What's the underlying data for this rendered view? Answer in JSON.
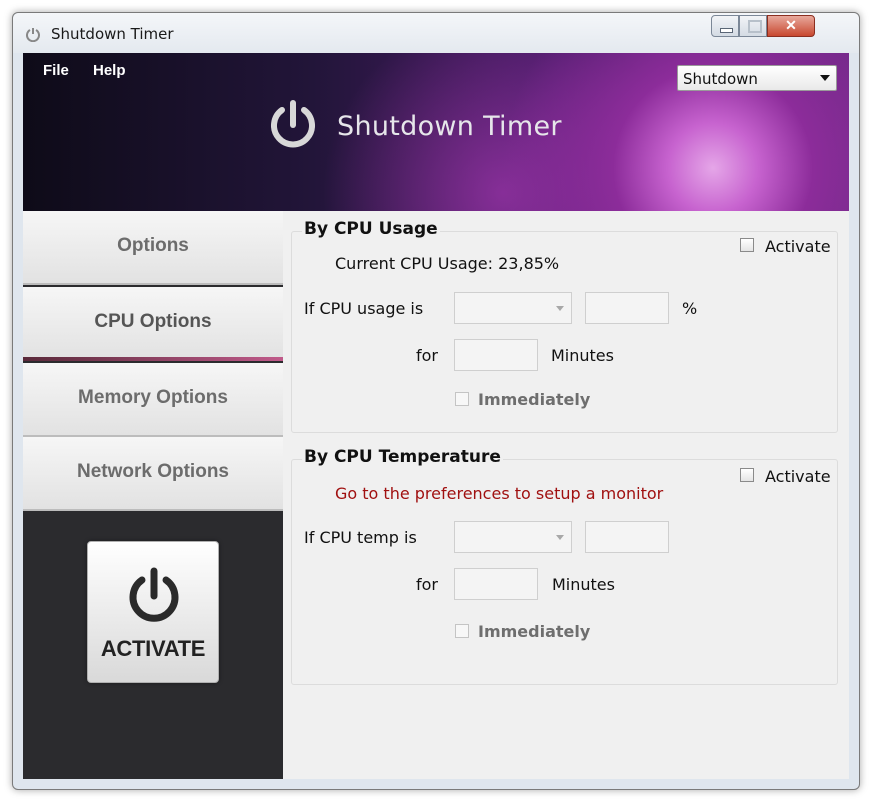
{
  "window": {
    "title": "Shutdown Timer"
  },
  "menu": {
    "file": "File",
    "help": "Help"
  },
  "header": {
    "app_name": "Shutdown Timer",
    "action_select": "Shutdown"
  },
  "sidebar": {
    "tabs": [
      {
        "label": "Options"
      },
      {
        "label": "CPU Options",
        "active": true
      },
      {
        "label": "Memory Options"
      },
      {
        "label": "Network Options"
      }
    ],
    "activate_label": "ACTIVATE"
  },
  "cpu_usage": {
    "title": "By CPU Usage",
    "activate_label": "Activate",
    "current": "Current CPU Usage: 23,85%",
    "if_label": "If CPU usage is",
    "unit": "%",
    "for_label": "for",
    "minutes_label": "Minutes",
    "immediately_label": "Immediately"
  },
  "cpu_temp": {
    "title": "By CPU Temperature",
    "activate_label": "Activate",
    "message": "Go to the preferences to setup a monitor",
    "if_label": "If CPU temp is",
    "for_label": "for",
    "minutes_label": "Minutes",
    "immediately_label": "Immediately"
  },
  "colors": {
    "accent": "#c05a8a",
    "warning_text": "#a01010"
  }
}
